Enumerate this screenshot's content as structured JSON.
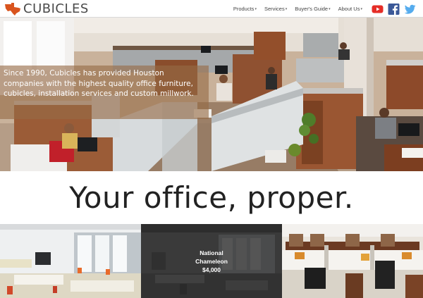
{
  "header": {
    "brand": "CUBICLES",
    "menu": [
      {
        "label": "Products",
        "key": "products"
      },
      {
        "label": "Services",
        "key": "services"
      },
      {
        "label": "Buyer's Guide",
        "key": "guide"
      },
      {
        "label": "About Us",
        "key": "about"
      }
    ],
    "social": [
      {
        "name": "youtube-icon",
        "color": "#e52d27"
      },
      {
        "name": "facebook-icon",
        "color": "#3b5998"
      },
      {
        "name": "twitter-icon",
        "color": "#55acee"
      }
    ],
    "logo_icon": "texas-icon",
    "logo_color": "#d9541e"
  },
  "hero": {
    "text": "Since 1990, Cubicles has provided Houston companies with the highest quality office furniture, cubicles, installation services and custom millwork."
  },
  "tagline": "Your office, proper.",
  "tiles": [
    {
      "key": "white-workstations"
    },
    {
      "key": "national-chameleon",
      "caption_line1": "National",
      "caption_line2": "Chameleon",
      "price": "$4,000"
    },
    {
      "key": "wood-cubicles"
    }
  ]
}
